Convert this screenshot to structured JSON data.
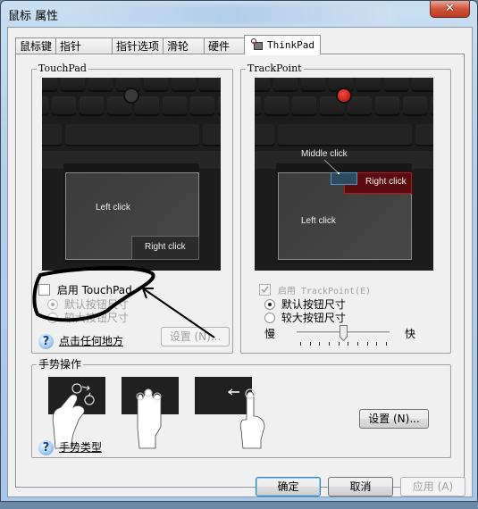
{
  "window": {
    "title": "鼠标 属性",
    "close_label": "✕"
  },
  "tabs": [
    {
      "label": "鼠标键"
    },
    {
      "label": "指针"
    },
    {
      "label": "指针选项"
    },
    {
      "label": "滑轮"
    },
    {
      "label": "硬件"
    },
    {
      "label": "ThinkPad",
      "active": true,
      "icon": "thinkpad-mouse-icon"
    }
  ],
  "touchpad": {
    "group_label": "TouchPad",
    "image": {
      "left_click": "Left click",
      "right_click": "Right click"
    },
    "enable_label": "启用 TouchPad",
    "enable_checked": false,
    "options": [
      {
        "label": "默认按钮尺寸",
        "selected": true,
        "disabled": true
      },
      {
        "label": "较大按钮尺寸",
        "selected": false,
        "disabled": true
      }
    ],
    "help_link": "点击任何地方",
    "settings_button": "设置 (N)..."
  },
  "trackpoint": {
    "group_label": "TrackPoint",
    "image": {
      "left_click": "Left click",
      "right_click": "Right click",
      "middle_click": "Middle click"
    },
    "enable_label": "启用 TrackPoint(E)",
    "enable_checked": true,
    "options": [
      {
        "label": "默认按钮尺寸",
        "selected": true
      },
      {
        "label": "较大按钮尺寸",
        "selected": false
      }
    ],
    "speed": {
      "slow_label": "慢",
      "fast_label": "快",
      "value_fraction": 0.5,
      "tick_count": 10
    }
  },
  "gestures": {
    "group_label": "手势操作",
    "items": [
      {
        "name": "rotate-gesture"
      },
      {
        "name": "three-finger-gesture"
      },
      {
        "name": "edge-swipe-gesture"
      }
    ],
    "settings_button": "设置 (N)...",
    "help_link": "手势类型"
  },
  "footer": {
    "ok": "确定",
    "cancel": "取消",
    "apply": "应用 (A)"
  },
  "colors": {
    "trackpoint_red": "#c8201a",
    "middle_click_blue": "#3b7ea8",
    "right_click_red": "#b0121a"
  }
}
